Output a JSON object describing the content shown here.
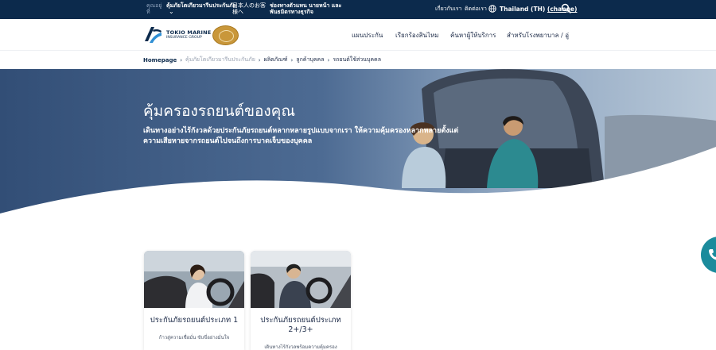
{
  "topbar": {
    "label_you_are": "คุณอยู่ที่",
    "item_insurance": "คุ้มภัยโตเกียวมารีนประกันภัย",
    "item_japanese": "日本人のお客様へ",
    "item_channels": "ช่องทางตัวแทน นายหน้า และพันธมิตรทางธุรกิจ",
    "link_about": "เกี่ยวกับเรา",
    "link_contact": "ติดต่อเรา",
    "region_label": "Thailand (TH)",
    "region_change": "(change)"
  },
  "header": {
    "logo_line1": "TOKIO MARINE",
    "logo_line2": "INSURANCE GROUP",
    "nav": [
      "แผนประกัน",
      "เรียกร้องสินไหม",
      "ค้นหาผู้ให้บริการ",
      "สำหรับโรงพยาบาล / อู่"
    ]
  },
  "breadcrumb": {
    "home": "Homepage",
    "level1": "คุ้มภัยโตเกียวมารีนประกันภัย",
    "level2": "ผลิตภัณฑ์",
    "level3": "ลูกค้าบุคคล",
    "current": "รถยนต์ใช้ส่วนบุคคล"
  },
  "hero": {
    "title": "คุ้มครองรถยนต์ของคุณ",
    "subtitle": "เดินทางอย่างไร้กังวลด้วยประกันภัยรถยนต์หลากหลายรูปแบบจากเรา ให้ความคุ้มครองหลากหลายตั้งแต่ความเสียหายจากรถยนต์ไปจนถึงการบาดเจ็บของบุคคล"
  },
  "cards": [
    {
      "title": "ประกันภัยรถยนต์ประเภท 1",
      "desc": "ก้าวสู่ความเชื่อมั่น ขับขี่อย่างมั่นใจ"
    },
    {
      "title": "ประกันภัยรถยนต์ประเภท 2+/3+",
      "desc": "เดินทางไร้กังวลพร้อมความคุ้มครอง"
    }
  ],
  "colors": {
    "topbar": "#0c2a4c",
    "accent": "#1b8b9c",
    "text": "#1d2b48"
  },
  "icons": [
    "globe-icon",
    "search-icon",
    "chevron-right-icon",
    "chevron-down-icon",
    "phone-icon"
  ]
}
